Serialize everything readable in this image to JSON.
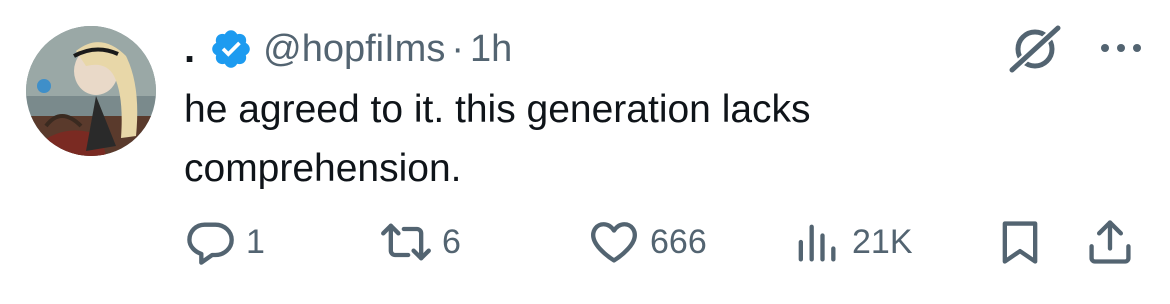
{
  "tweet": {
    "display_name": ".",
    "handle": "@hopfiIms",
    "separator": "·",
    "time": "1h",
    "text_line1": "he agreed to it. this generation lacks",
    "text_line2": "comprehension.",
    "verified": true
  },
  "actions": {
    "reply_count": "1",
    "retweet_count": "6",
    "like_count": "666",
    "views_count": "21K"
  },
  "colors": {
    "text": "#0f1419",
    "secondary": "#536471",
    "verified": "#1d9bf0"
  },
  "icons": {
    "verified": "verified-badge-icon",
    "grok": "grok-icon",
    "more": "more-icon",
    "reply": "reply-icon",
    "retweet": "retweet-icon",
    "like": "heart-icon",
    "views": "views-icon",
    "bookmark": "bookmark-icon",
    "share": "share-icon"
  }
}
